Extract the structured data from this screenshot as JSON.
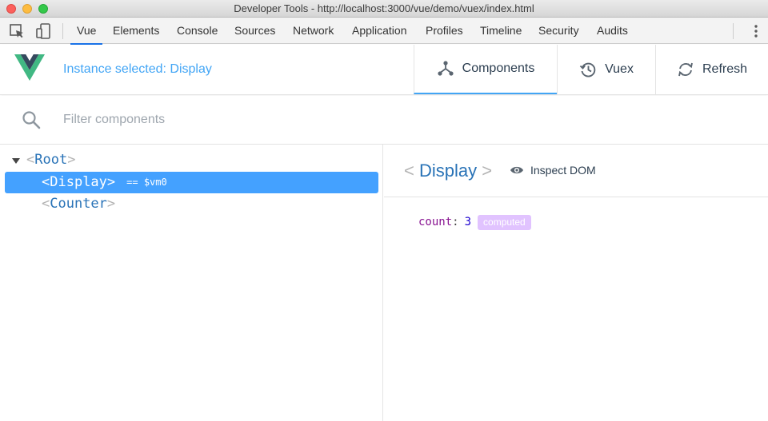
{
  "window": {
    "title": "Developer Tools - http://localhost:3000/vue/demo/vuex/index.html"
  },
  "devtools_tabs": [
    "Vue",
    "Elements",
    "Console",
    "Sources",
    "Network",
    "Application",
    "Profiles",
    "Timeline",
    "Security",
    "Audits"
  ],
  "active_devtools_tab": "Vue",
  "vue_header": {
    "instance_label": "Instance selected: Display",
    "buttons": {
      "components": "Components",
      "vuex": "Vuex",
      "refresh": "Refresh"
    },
    "active_button": "Components",
    "accent_color": "#42a5f5"
  },
  "filter": {
    "placeholder": "Filter components",
    "value": ""
  },
  "tree": {
    "root": "Root",
    "children": [
      {
        "name": "Display",
        "selected": true,
        "ref": "== $vm0"
      },
      {
        "name": "Counter",
        "selected": false
      }
    ],
    "open_bracket": "<",
    "close_bracket": ">"
  },
  "inspector": {
    "component_name": "Display",
    "inspect_dom_label": "Inspect DOM",
    "state": [
      {
        "key": "count",
        "value": "3",
        "badge": "computed"
      }
    ]
  },
  "icons": {
    "inspect": "element-picker-icon",
    "device": "device-toolbar-icon",
    "more": "kebab-menu-icon",
    "components": "components-tree-icon",
    "vuex": "history-icon",
    "refresh": "refresh-icon",
    "search": "search-icon",
    "eye": "eye-icon"
  }
}
